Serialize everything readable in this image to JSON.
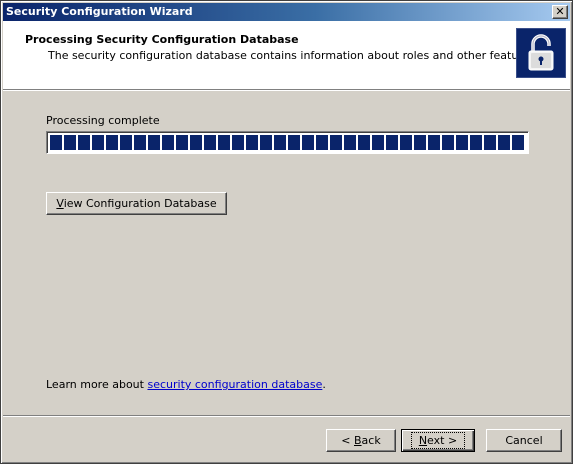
{
  "window": {
    "title": "Security Configuration Wizard",
    "close_glyph": "✕"
  },
  "header": {
    "title": "Processing Security Configuration Database",
    "subtitle": "The security configuration database contains information about roles and other features.",
    "icon": "padlock-icon"
  },
  "progress": {
    "label": "Processing complete",
    "percent": 100
  },
  "view_button": {
    "prefix": "",
    "accel": "V",
    "rest": "iew Configuration Database"
  },
  "learn_more": {
    "text": "Learn more about ",
    "link": "security configuration database",
    "suffix": "."
  },
  "nav": {
    "back": {
      "prefix": "< ",
      "accel": "B",
      "rest": "ack"
    },
    "next": {
      "accel": "N",
      "rest": "ext >"
    },
    "cancel": "Cancel"
  },
  "colors": {
    "title_bar": "#0a246a",
    "face": "#d4d0c8",
    "progress": "#0a246a",
    "link": "#0000cc"
  }
}
